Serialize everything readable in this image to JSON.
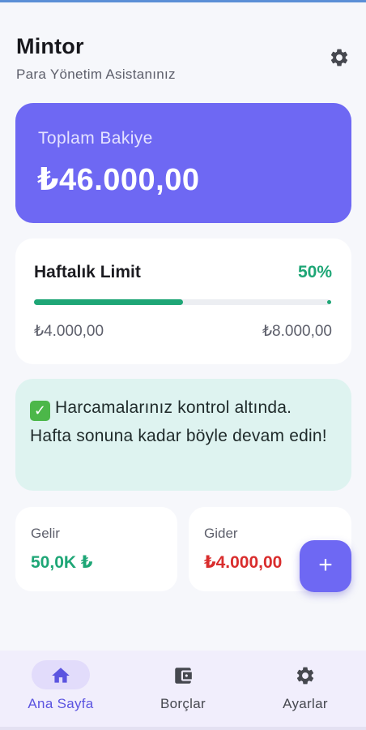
{
  "header": {
    "title": "Mintor",
    "subtitle": "Para Yönetim Asistanınız",
    "settings_icon": "gear-icon"
  },
  "balance": {
    "label": "Toplam Bakiye",
    "value": "₺46.000,00"
  },
  "weekly_limit": {
    "title": "Haftalık Limit",
    "percent_label": "50%",
    "progress": 0.5,
    "spent": "₺4.000,00",
    "limit": "₺8.000,00"
  },
  "info_message": {
    "icon": "check-icon",
    "text": "Harcamalarınız kontrol altında. Hafta sonuna kadar böyle devam edin!"
  },
  "stats": {
    "income_label": "Gelir",
    "income_value": "50,0K ₺",
    "expense_label": "Gider",
    "expense_value": "₺4.000,00"
  },
  "fab": {
    "icon": "plus-icon",
    "label": "+"
  },
  "nav": [
    {
      "label": "Ana Sayfa",
      "icon": "home-icon",
      "active": true
    },
    {
      "label": "Borçlar",
      "icon": "wallet-icon",
      "active": false
    },
    {
      "label": "Ayarlar",
      "icon": "gear-icon",
      "active": false
    }
  ],
  "colors": {
    "accent": "#6e68f3",
    "success": "#1ea676",
    "danger": "#d92d2d",
    "info_bg": "#def3f0"
  }
}
